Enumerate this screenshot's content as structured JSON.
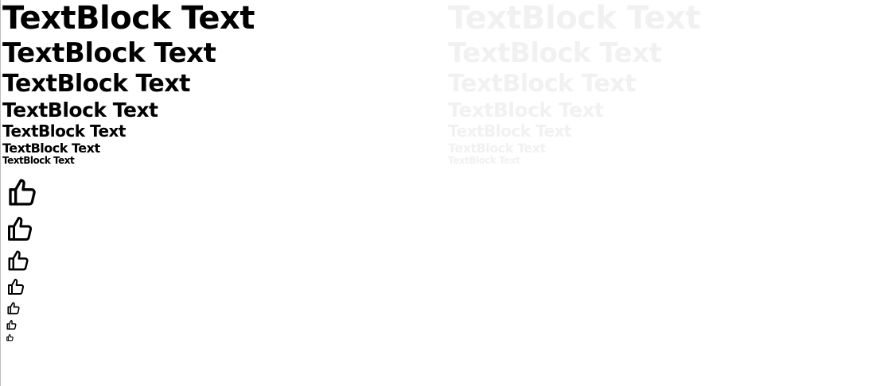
{
  "text_blocks": {
    "left": [
      "TextBlock Text",
      "TextBlock Text",
      "TextBlock Text",
      "TextBlock Text",
      "TextBlock Text",
      "TextBlock Text",
      "TextBlock Text"
    ],
    "right": [
      "TextBlock Text",
      "TextBlock Text",
      "TextBlock Text",
      "TextBlock Text",
      "TextBlock Text",
      "TextBlock Text",
      "TextBlock Text"
    ]
  },
  "icons": {
    "items": [
      "thumbs-up-icon",
      "thumbs-up-icon",
      "thumbs-up-icon",
      "thumbs-up-icon",
      "thumbs-up-icon",
      "thumbs-up-icon",
      "thumbs-up-icon"
    ]
  },
  "colors": {
    "text_enabled": "#000000",
    "text_disabled": "#f1f1f1",
    "background": "#ffffff"
  }
}
